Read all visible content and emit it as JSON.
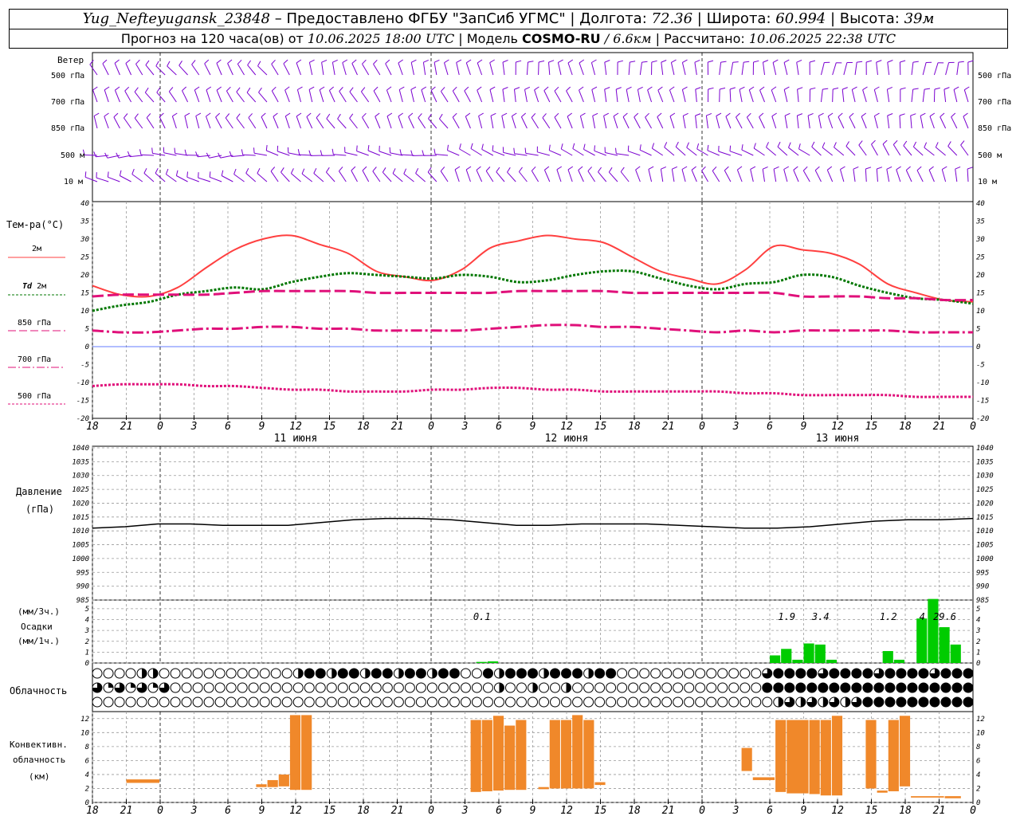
{
  "header": {
    "station": "Yug_Nefteyugansk_23848",
    "provided_by": "– Предоставлено ФГБУ \"ЗапСиб УГМС\"",
    "lon_label": "Долгота:",
    "lon": "72.36",
    "lat_label": "Широта:",
    "lat": "60.994",
    "alt_label": "Высота:",
    "alt": "39м",
    "forecast_label": "Прогноз на 120 часа(ов) от",
    "issued": "10.06.2025 18:00 UTC",
    "model_label": "Модель",
    "model": "COSMO-RU",
    "resolution": "/ 6.6км",
    "calc_label": "Рассчитано:",
    "calc": "10.06.2025 22:38 UTC"
  },
  "labels": {
    "wind": "Ветер",
    "levels": [
      "500 гПа",
      "700 гПа",
      "850 гПа",
      "500 м",
      "10 м"
    ],
    "temp": "Тем-ра(°C)",
    "t2m": "2м",
    "td": "Td",
    "td_suffix": "2м",
    "t850": "850 гПа",
    "t700": "700 гПа",
    "t500": "500 гПа",
    "pressure1": "Давление",
    "pressure2": "(гПа)",
    "precip1": "(мм/3ч.)",
    "precip2": "Осадки",
    "precip3": "(мм/1ч.)",
    "cloud": "Облачность",
    "conv1": "Конвективн.",
    "conv2": "облачность",
    "conv3": "(км)"
  },
  "colors": {
    "t2m": "#ff4040",
    "td": "#007700",
    "t850": "#e0107a",
    "t700": "#e0107a",
    "t500": "#e0107a",
    "wind": "#7a00d0",
    "pressure": "#000000",
    "precip": "#00cc00",
    "conv": "#f0882a"
  },
  "time_axis": {
    "hour_labels": [
      "18",
      "21",
      "0",
      "3",
      "6",
      "9",
      "12",
      "15",
      "18",
      "21",
      "0",
      "3",
      "6",
      "9",
      "12",
      "15",
      "18",
      "21",
      "0",
      "3",
      "6",
      "9",
      "12",
      "15",
      "18",
      "21",
      "0"
    ],
    "day_labels": [
      "11 июня",
      "12 июня",
      "13 июня"
    ]
  },
  "chart_data": [
    {
      "type": "line",
      "panel": "temperature",
      "y_ticks": [
        40,
        35,
        30,
        25,
        20,
        15,
        10,
        5,
        0,
        -5,
        -10,
        -15,
        -20
      ],
      "ylim": [
        -20,
        40
      ],
      "x_hours": [
        0,
        3,
        6,
        9,
        12,
        15,
        18,
        21,
        24,
        27,
        30,
        33,
        36,
        39,
        42,
        45,
        48,
        51,
        54,
        57,
        60,
        63,
        66,
        69,
        72
      ],
      "series": [
        {
          "name": "2м",
          "values": [
            17,
            14.5,
            14,
            16.5,
            22,
            27,
            30,
            31,
            28.5,
            26,
            21,
            19.5,
            18.5,
            21.5,
            27.5,
            29.5,
            31,
            30,
            29,
            25,
            21,
            19,
            17.5,
            21.5,
            28,
            27,
            26,
            23,
            17.5,
            15,
            13,
            12.5
          ]
        },
        {
          "name": "Td 2м",
          "values": [
            10,
            11.5,
            12.5,
            14.5,
            15.5,
            16.5,
            16,
            18,
            19.5,
            20.5,
            20,
            19.5,
            19,
            20,
            19.5,
            18,
            18.5,
            20,
            21,
            21,
            19,
            17,
            16,
            17.5,
            18,
            20,
            19.5,
            17,
            15,
            13.5,
            13,
            12
          ]
        },
        {
          "name": "850 гПа",
          "values": [
            14,
            14.5,
            14.5,
            14.5,
            14.5,
            15,
            15.5,
            15.5,
            15.5,
            15.5,
            15,
            15,
            15,
            15,
            15,
            15.5,
            15.5,
            15.5,
            15.5,
            15,
            15,
            15,
            15,
            15,
            15,
            14,
            14,
            14,
            13.5,
            13.5,
            13,
            13
          ]
        },
        {
          "name": "700 гПа",
          "values": [
            4.5,
            4,
            4,
            4.5,
            5,
            5,
            5.5,
            5.5,
            5,
            5,
            4.5,
            4.5,
            4.5,
            4.5,
            5,
            5.5,
            6,
            6,
            5.5,
            5.5,
            5,
            4.5,
            4,
            4.5,
            4,
            4.5,
            4.5,
            4.5,
            4.5,
            4,
            4,
            4
          ]
        },
        {
          "name": "500 гПа",
          "values": [
            -11,
            -10.5,
            -10.5,
            -10.5,
            -11,
            -11,
            -11.5,
            -12,
            -12,
            -12.5,
            -12.5,
            -12.5,
            -12,
            -12,
            -11.5,
            -11.5,
            -12,
            -12,
            -12.5,
            -12.5,
            -12.5,
            -12.5,
            -12.5,
            -13,
            -13,
            -13.5,
            -13.5,
            -13.5,
            -13.5,
            -14,
            -14,
            -14
          ]
        }
      ]
    },
    {
      "type": "line",
      "panel": "pressure",
      "y_ticks": [
        1040,
        1035,
        1030,
        1025,
        1020,
        1015,
        1010,
        1005,
        1000,
        995,
        990,
        985
      ],
      "ylim": [
        985,
        1040
      ],
      "series": [
        {
          "name": "Давление",
          "values": [
            1011,
            1011.5,
            1012.5,
            1012.5,
            1012,
            1012,
            1012,
            1013,
            1014,
            1014.5,
            1014.5,
            1014,
            1013,
            1012,
            1012,
            1012.5,
            1012.5,
            1012.5,
            1012,
            1011.5,
            1011,
            1011,
            1011.5,
            1012.5,
            1013.5,
            1014,
            1014,
            1014.5
          ]
        }
      ]
    },
    {
      "type": "bar",
      "panel": "precipitation",
      "y_ticks": [
        5,
        4,
        3,
        2,
        1,
        0
      ],
      "ylim": [
        0,
        5.8
      ],
      "annotations": [
        {
          "text": "0.1",
          "hour": 34.5
        },
        {
          "text": "1.9",
          "hour": 61.5
        },
        {
          "text": "3.4",
          "hour": 64.5
        },
        {
          "text": "1.2",
          "hour": 70.5
        },
        {
          "text": "4",
          "hour": 73.5
        },
        {
          "text": "29.6",
          "hour": 75.5
        }
      ],
      "bars": [
        {
          "hour": 34,
          "value": 0.1
        },
        {
          "hour": 35,
          "value": 0.15
        },
        {
          "hour": 60,
          "value": 0.7
        },
        {
          "hour": 61,
          "value": 1.3
        },
        {
          "hour": 62,
          "value": 0.3
        },
        {
          "hour": 63,
          "value": 1.8
        },
        {
          "hour": 64,
          "value": 1.7
        },
        {
          "hour": 65,
          "value": 0.3
        },
        {
          "hour": 70,
          "value": 1.1
        },
        {
          "hour": 71,
          "value": 0.3
        },
        {
          "hour": 73,
          "value": 4.1
        },
        {
          "hour": 74,
          "value": 5.9
        },
        {
          "hour": 75,
          "value": 3.3
        },
        {
          "hour": 76,
          "value": 1.7
        }
      ]
    },
    {
      "type": "bar",
      "panel": "convective_cloud",
      "y_ticks": [
        12,
        10,
        8,
        6,
        4,
        2,
        0
      ],
      "ylim": [
        0,
        13
      ],
      "bars": [
        {
          "start": 3,
          "end": 6,
          "bottom": 2.8,
          "top": 3.3
        },
        {
          "start": 14.5,
          "end": 15.5,
          "bottom": 2.2,
          "top": 2.6
        },
        {
          "start": 15.5,
          "end": 16.5,
          "bottom": 2.2,
          "top": 3.2
        },
        {
          "start": 16.5,
          "end": 17.5,
          "bottom": 2.3,
          "top": 4
        },
        {
          "start": 17.5,
          "end": 18.5,
          "bottom": 1.8,
          "top": 12.5
        },
        {
          "start": 18.5,
          "end": 19.5,
          "bottom": 1.8,
          "top": 12.5
        },
        {
          "start": 33.5,
          "end": 34.5,
          "bottom": 1.5,
          "top": 11.8
        },
        {
          "start": 34.5,
          "end": 35.5,
          "bottom": 1.6,
          "top": 11.8
        },
        {
          "start": 35.5,
          "end": 36.5,
          "bottom": 1.7,
          "top": 12.4
        },
        {
          "start": 36.5,
          "end": 37.5,
          "bottom": 1.8,
          "top": 11
        },
        {
          "start": 37.5,
          "end": 38.5,
          "bottom": 1.8,
          "top": 11.8
        },
        {
          "start": 39.5,
          "end": 40.5,
          "bottom": 1.9,
          "top": 2.2
        },
        {
          "start": 40.5,
          "end": 41.5,
          "bottom": 2,
          "top": 11.8
        },
        {
          "start": 41.5,
          "end": 42.5,
          "bottom": 2,
          "top": 11.8
        },
        {
          "start": 42.5,
          "end": 43.5,
          "bottom": 2,
          "top": 12.5
        },
        {
          "start": 43.5,
          "end": 44.5,
          "bottom": 2,
          "top": 11.8
        },
        {
          "start": 44.5,
          "end": 45.5,
          "bottom": 2.5,
          "top": 2.9
        },
        {
          "start": 57.5,
          "end": 58.5,
          "bottom": 4.5,
          "top": 7.8
        },
        {
          "start": 58.5,
          "end": 60.5,
          "bottom": 3.2,
          "top": 3.6
        },
        {
          "start": 60.5,
          "end": 61.5,
          "bottom": 1.5,
          "top": 11.8
        },
        {
          "start": 61.5,
          "end": 63.5,
          "bottom": 1.3,
          "top": 11.8
        },
        {
          "start": 63.5,
          "end": 64.5,
          "bottom": 1.2,
          "top": 11.8
        },
        {
          "start": 64.5,
          "end": 65.5,
          "bottom": 1,
          "top": 11.8
        },
        {
          "start": 65.5,
          "end": 66.5,
          "bottom": 1,
          "top": 12.4
        },
        {
          "start": 68.5,
          "end": 69.5,
          "bottom": 2,
          "top": 11.8
        },
        {
          "start": 69.5,
          "end": 70.5,
          "bottom": 1.4,
          "top": 1.7
        },
        {
          "start": 70.5,
          "end": 71.5,
          "bottom": 1.6,
          "top": 11.8
        },
        {
          "start": 71.5,
          "end": 72.5,
          "bottom": 2.3,
          "top": 12.4
        },
        {
          "start": 72.5,
          "end": 75.5,
          "bottom": 0.7,
          "top": 0.9
        },
        {
          "start": 75.5,
          "end": 77,
          "bottom": 0.6,
          "top": 0.9
        }
      ]
    }
  ]
}
